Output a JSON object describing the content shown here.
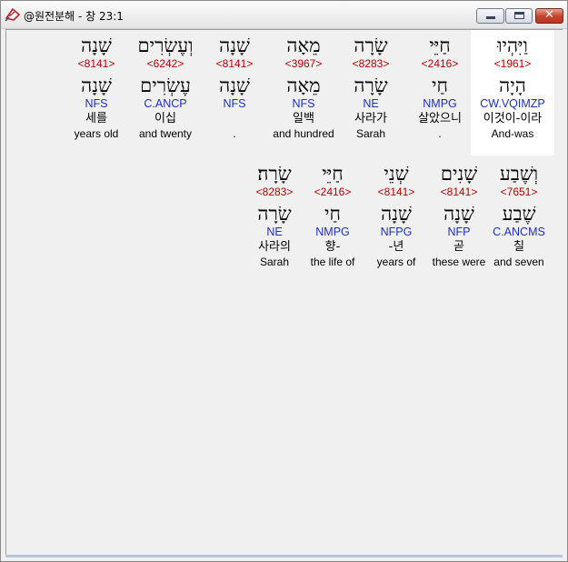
{
  "window": {
    "title": "@원전분해 - 창 23:1",
    "close_glyph": "✕"
  },
  "rows": [
    {
      "words": [
        {
          "heb": "וַיִּהְיוּ",
          "strong": "<1961>",
          "lemma": "הָיָה",
          "parse": "CW.VQIMZP",
          "korean": "이것이-이라",
          "english": "And-was",
          "highlight": true
        },
        {
          "heb": "חַיֵּי",
          "strong": "<2416>",
          "lemma": "חַי",
          "parse": "NMPG",
          "korean": "살았으니",
          "english": "."
        },
        {
          "heb": "שָׂרָה",
          "strong": "<8283>",
          "lemma": "שָׂרָה",
          "parse": "NE",
          "korean": "사라가",
          "english": "Sarah"
        },
        {
          "heb": "מֵאָה",
          "strong": "<3967>",
          "lemma": "מֵאָה",
          "parse": "NFS",
          "korean": "일백",
          "english": "and hundred"
        },
        {
          "heb": "שָׁנָה",
          "strong": "<8141>",
          "lemma": "שָׁנָה",
          "parse": "NFS",
          "korean": "",
          "english": "."
        },
        {
          "heb": "וְעֶשְׂרִים",
          "strong": "<6242>",
          "lemma": "עֶשְׂרִים",
          "parse": "C.ANCP",
          "korean": "이십",
          "english": "and twenty"
        },
        {
          "heb": "שָׁנָה",
          "strong": "<8141>",
          "lemma": "שָׁנָה",
          "parse": "NFS",
          "korean": "세를",
          "english": "years old"
        }
      ]
    },
    {
      "words": [
        {
          "heb": "וְשֶׁבַע",
          "strong": "<7651>",
          "lemma": "שֶׁבַע",
          "parse": "C.ANCMS",
          "korean": "칠",
          "english": "and seven"
        },
        {
          "heb": "שָׁנִים",
          "strong": "<8141>",
          "lemma": "שָׁנָה",
          "parse": "NFP",
          "korean": "곧",
          "english": "these were"
        },
        {
          "heb": "שְׁנֵי",
          "strong": "<8141>",
          "lemma": "שָׁנָה",
          "parse": "NFPG",
          "korean": "-년",
          "english": "years of"
        },
        {
          "heb": "חַיֵּי",
          "strong": "<2416>",
          "lemma": "חַי",
          "parse": "NMPG",
          "korean": "향-",
          "english": "the life of"
        },
        {
          "heb": "שָׂרָה׃",
          "strong": "<8283>",
          "lemma": "שָׂרָה",
          "parse": "NE",
          "korean": "사라의",
          "english": "Sarah"
        }
      ]
    }
  ]
}
